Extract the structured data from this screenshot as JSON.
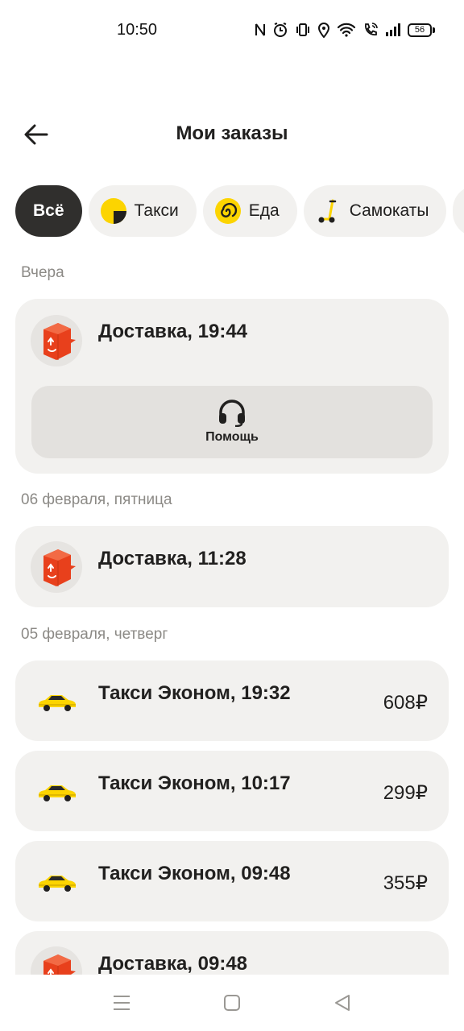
{
  "status": {
    "time": "10:50",
    "battery": "56"
  },
  "header": {
    "title": "Мои заказы"
  },
  "filters": [
    {
      "label": "Всё",
      "icon": "none"
    },
    {
      "label": "Такси",
      "icon": "taxi-icon"
    },
    {
      "label": "Еда",
      "icon": "food-icon"
    },
    {
      "label": "Самокаты",
      "icon": "scooter-icon"
    }
  ],
  "sections": [
    {
      "label": "Вчера",
      "orders": [
        {
          "title": "Доставка, 19:44",
          "icon": "delivery-box-icon",
          "help_label": "Помощь"
        }
      ]
    },
    {
      "label": "06 февраля, пятница",
      "orders": [
        {
          "title": "Доставка, 11:28",
          "icon": "delivery-box-icon"
        }
      ]
    },
    {
      "label": "05 февраля, четверг",
      "orders": [
        {
          "title": "Такси Эконом, 19:32",
          "price": "608₽",
          "icon": "taxi-car-icon"
        },
        {
          "title": "Такси Эконом, 10:17",
          "price": "299₽",
          "icon": "taxi-car-icon"
        },
        {
          "title": "Такси Эконом, 09:48",
          "price": "355₽",
          "icon": "taxi-car-icon"
        },
        {
          "title": "Доставка, 09:48",
          "icon": "delivery-box-icon"
        }
      ]
    }
  ],
  "colors": {
    "card_bg": "#f2f1ef",
    "active_chip": "#302f2d",
    "delivery_red": "#e8401c",
    "taxi_yellow": "#fcd400"
  }
}
